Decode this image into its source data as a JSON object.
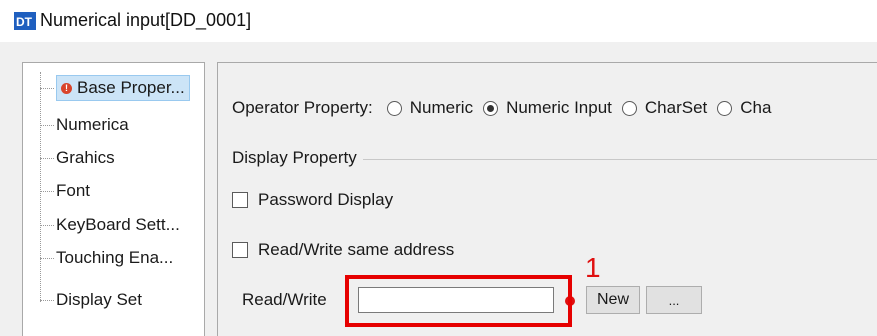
{
  "window": {
    "title": "Numerical input[DD_0001]",
    "app_icon": "dt-app-icon"
  },
  "tree": {
    "items": [
      {
        "label": "Base Proper...",
        "selected": true,
        "icon": "warning-icon",
        "icon_glyph": "!"
      },
      {
        "label": "Numerica"
      },
      {
        "label": "Grahics"
      },
      {
        "label": "Font"
      },
      {
        "label": "KeyBoard Sett..."
      },
      {
        "label": "Touching Ena..."
      },
      {
        "label": "Display Set"
      }
    ]
  },
  "operator": {
    "label": "Operator Property:",
    "options": [
      {
        "label": "Numeric",
        "checked": false
      },
      {
        "label": "Numeric Input",
        "checked": true
      },
      {
        "label": "CharSet",
        "checked": false
      },
      {
        "label": "Cha",
        "checked": false
      }
    ]
  },
  "display": {
    "group_title": "Display Property",
    "password_label": "Password Display",
    "same_address_label": "Read/Write same address",
    "rw_label": "Read/Write",
    "rw_value": "",
    "new_button": "New",
    "browse_button": "..."
  },
  "annotation": {
    "number": "1",
    "color": "#e01010"
  },
  "colors": {
    "selection": "#cce4f7",
    "highlight_box": "#e60000",
    "panel_bg": "#f0f0f0"
  }
}
